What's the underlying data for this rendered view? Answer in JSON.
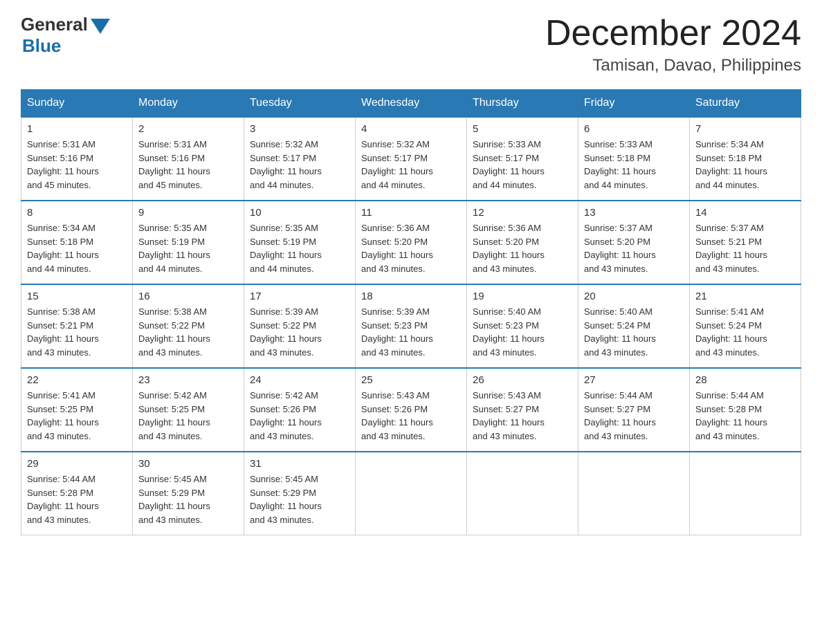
{
  "header": {
    "logo_general": "General",
    "logo_blue": "Blue",
    "month_title": "December 2024",
    "location": "Tamisan, Davao, Philippines"
  },
  "days_of_week": [
    "Sunday",
    "Monday",
    "Tuesday",
    "Wednesday",
    "Thursday",
    "Friday",
    "Saturday"
  ],
  "weeks": [
    [
      {
        "day": "1",
        "sunrise": "5:31 AM",
        "sunset": "5:16 PM",
        "daylight": "11 hours and 45 minutes."
      },
      {
        "day": "2",
        "sunrise": "5:31 AM",
        "sunset": "5:16 PM",
        "daylight": "11 hours and 45 minutes."
      },
      {
        "day": "3",
        "sunrise": "5:32 AM",
        "sunset": "5:17 PM",
        "daylight": "11 hours and 44 minutes."
      },
      {
        "day": "4",
        "sunrise": "5:32 AM",
        "sunset": "5:17 PM",
        "daylight": "11 hours and 44 minutes."
      },
      {
        "day": "5",
        "sunrise": "5:33 AM",
        "sunset": "5:17 PM",
        "daylight": "11 hours and 44 minutes."
      },
      {
        "day": "6",
        "sunrise": "5:33 AM",
        "sunset": "5:18 PM",
        "daylight": "11 hours and 44 minutes."
      },
      {
        "day": "7",
        "sunrise": "5:34 AM",
        "sunset": "5:18 PM",
        "daylight": "11 hours and 44 minutes."
      }
    ],
    [
      {
        "day": "8",
        "sunrise": "5:34 AM",
        "sunset": "5:18 PM",
        "daylight": "11 hours and 44 minutes."
      },
      {
        "day": "9",
        "sunrise": "5:35 AM",
        "sunset": "5:19 PM",
        "daylight": "11 hours and 44 minutes."
      },
      {
        "day": "10",
        "sunrise": "5:35 AM",
        "sunset": "5:19 PM",
        "daylight": "11 hours and 44 minutes."
      },
      {
        "day": "11",
        "sunrise": "5:36 AM",
        "sunset": "5:20 PM",
        "daylight": "11 hours and 43 minutes."
      },
      {
        "day": "12",
        "sunrise": "5:36 AM",
        "sunset": "5:20 PM",
        "daylight": "11 hours and 43 minutes."
      },
      {
        "day": "13",
        "sunrise": "5:37 AM",
        "sunset": "5:20 PM",
        "daylight": "11 hours and 43 minutes."
      },
      {
        "day": "14",
        "sunrise": "5:37 AM",
        "sunset": "5:21 PM",
        "daylight": "11 hours and 43 minutes."
      }
    ],
    [
      {
        "day": "15",
        "sunrise": "5:38 AM",
        "sunset": "5:21 PM",
        "daylight": "11 hours and 43 minutes."
      },
      {
        "day": "16",
        "sunrise": "5:38 AM",
        "sunset": "5:22 PM",
        "daylight": "11 hours and 43 minutes."
      },
      {
        "day": "17",
        "sunrise": "5:39 AM",
        "sunset": "5:22 PM",
        "daylight": "11 hours and 43 minutes."
      },
      {
        "day": "18",
        "sunrise": "5:39 AM",
        "sunset": "5:23 PM",
        "daylight": "11 hours and 43 minutes."
      },
      {
        "day": "19",
        "sunrise": "5:40 AM",
        "sunset": "5:23 PM",
        "daylight": "11 hours and 43 minutes."
      },
      {
        "day": "20",
        "sunrise": "5:40 AM",
        "sunset": "5:24 PM",
        "daylight": "11 hours and 43 minutes."
      },
      {
        "day": "21",
        "sunrise": "5:41 AM",
        "sunset": "5:24 PM",
        "daylight": "11 hours and 43 minutes."
      }
    ],
    [
      {
        "day": "22",
        "sunrise": "5:41 AM",
        "sunset": "5:25 PM",
        "daylight": "11 hours and 43 minutes."
      },
      {
        "day": "23",
        "sunrise": "5:42 AM",
        "sunset": "5:25 PM",
        "daylight": "11 hours and 43 minutes."
      },
      {
        "day": "24",
        "sunrise": "5:42 AM",
        "sunset": "5:26 PM",
        "daylight": "11 hours and 43 minutes."
      },
      {
        "day": "25",
        "sunrise": "5:43 AM",
        "sunset": "5:26 PM",
        "daylight": "11 hours and 43 minutes."
      },
      {
        "day": "26",
        "sunrise": "5:43 AM",
        "sunset": "5:27 PM",
        "daylight": "11 hours and 43 minutes."
      },
      {
        "day": "27",
        "sunrise": "5:44 AM",
        "sunset": "5:27 PM",
        "daylight": "11 hours and 43 minutes."
      },
      {
        "day": "28",
        "sunrise": "5:44 AM",
        "sunset": "5:28 PM",
        "daylight": "11 hours and 43 minutes."
      }
    ],
    [
      {
        "day": "29",
        "sunrise": "5:44 AM",
        "sunset": "5:28 PM",
        "daylight": "11 hours and 43 minutes."
      },
      {
        "day": "30",
        "sunrise": "5:45 AM",
        "sunset": "5:29 PM",
        "daylight": "11 hours and 43 minutes."
      },
      {
        "day": "31",
        "sunrise": "5:45 AM",
        "sunset": "5:29 PM",
        "daylight": "11 hours and 43 minutes."
      },
      null,
      null,
      null,
      null
    ]
  ],
  "labels": {
    "sunrise": "Sunrise:",
    "sunset": "Sunset:",
    "daylight": "Daylight:"
  }
}
